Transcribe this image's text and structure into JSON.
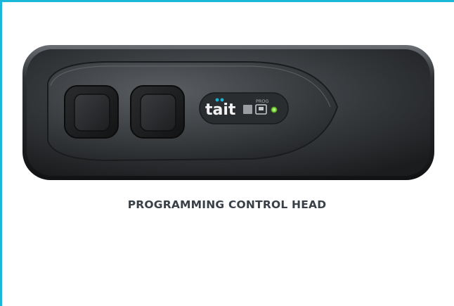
{
  "device": {
    "brand": "tait",
    "prog_label": "PROG"
  },
  "caption": {
    "text": "PROGRAMMING CONTROL HEAD"
  },
  "colors": {
    "accent_frame": "#1ab8d8",
    "caption_text": "#3a4048",
    "brand_dots": "#19b3d6",
    "status_led": "#7fdc3a",
    "device_body": "#2b2e31"
  },
  "icons": {
    "button_left": "rounded-square-button",
    "button_right": "rounded-square-button",
    "prog_port": "port-icon",
    "status_led": "led-indicator"
  }
}
